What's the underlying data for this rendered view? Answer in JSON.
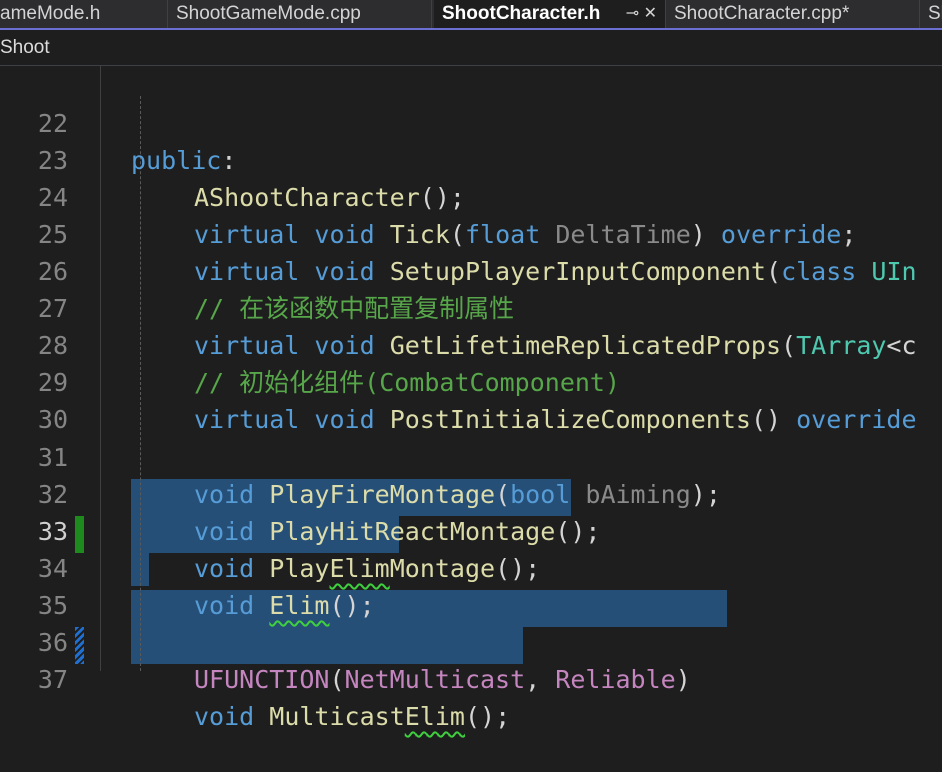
{
  "tabs": [
    {
      "label": "ameMode.h"
    },
    {
      "label": "ShootGameMode.cpp"
    },
    {
      "label": "ShootCharacter.h",
      "icons": "⊸ ✕"
    },
    {
      "label": "ShootCharacter.cpp*"
    },
    {
      "label": "Sh"
    }
  ],
  "nav": {
    "scope": "Shoot"
  },
  "lines": [
    {
      "n": "22"
    },
    {
      "n": "23"
    },
    {
      "n": "24"
    },
    {
      "n": "25"
    },
    {
      "n": "26"
    },
    {
      "n": "27"
    },
    {
      "n": "28"
    },
    {
      "n": "29"
    },
    {
      "n": "30"
    },
    {
      "n": "31"
    },
    {
      "n": "32"
    },
    {
      "n": "33"
    },
    {
      "n": "34"
    },
    {
      "n": "35"
    },
    {
      "n": "36"
    },
    {
      "n": "37"
    }
  ],
  "code": {
    "l22": {
      "kw": "public",
      "rest": ":"
    },
    "l23": {
      "fn": "AShootCharacter",
      "rest": "();"
    },
    "l24": {
      "kw1": "virtual",
      "kw2": "void",
      "fn": "Tick",
      "p1": "(",
      "kw3": "float",
      "pm": "DeltaTime",
      "p2": ")",
      "kw4": "override",
      "p3": ";"
    },
    "l25": {
      "kw1": "virtual",
      "kw2": "void",
      "fn": "SetupPlayerInputComponent",
      "p1": "(",
      "kw3": "class",
      "ty": "UIn"
    },
    "l26": {
      "comment": "// 在该函数中配置复制属性"
    },
    "l27": {
      "kw1": "virtual",
      "kw2": "void",
      "fn": "GetLifetimeReplicatedProps",
      "p1": "(",
      "ty": "TArray",
      "p2": "<c"
    },
    "l28": {
      "comment": "// 初始化组件(CombatComponent)"
    },
    "l29": {
      "kw1": "virtual",
      "kw2": "void",
      "fn": "PostInitializeComponents",
      "p1": "() ",
      "kw3": "override"
    },
    "l31": {
      "kw": "void",
      "fn": "PlayFireMontage",
      "p1": "(",
      "kw2": "bool",
      "pm": "bAiming",
      "p2": ");"
    },
    "l32": {
      "kw": "void",
      "fn": "PlayHitReactMontage",
      "p1": "();"
    },
    "l33": {
      "kw": "void",
      "fn_a": "Play",
      "fn_b": "Elim",
      "fn_c": "Montage",
      "p1": "();"
    },
    "l34": {
      "kw": "void",
      "fn": "Elim",
      "p1": "();"
    },
    "l36": {
      "mc": "UFUNCTION",
      "p1": "(",
      "mc2": "NetMulticast",
      "p2": ", ",
      "mc3": "Reliable",
      "p3": ")"
    },
    "l37": {
      "kw": "void",
      "fn_a": "Multicast",
      "fn_b": "Elim",
      "p1": "();"
    }
  },
  "colors": {
    "background": "#1e1e1e",
    "selection": "#264f78",
    "keyword": "#569cd6",
    "function": "#dcdcaa",
    "type": "#4ec9b0",
    "param": "#9cdcfe",
    "comment": "#57a64a",
    "macro": "#c586c0",
    "change_saved": "#1e8a1e",
    "change_unsaved": "#1f6fd1"
  }
}
